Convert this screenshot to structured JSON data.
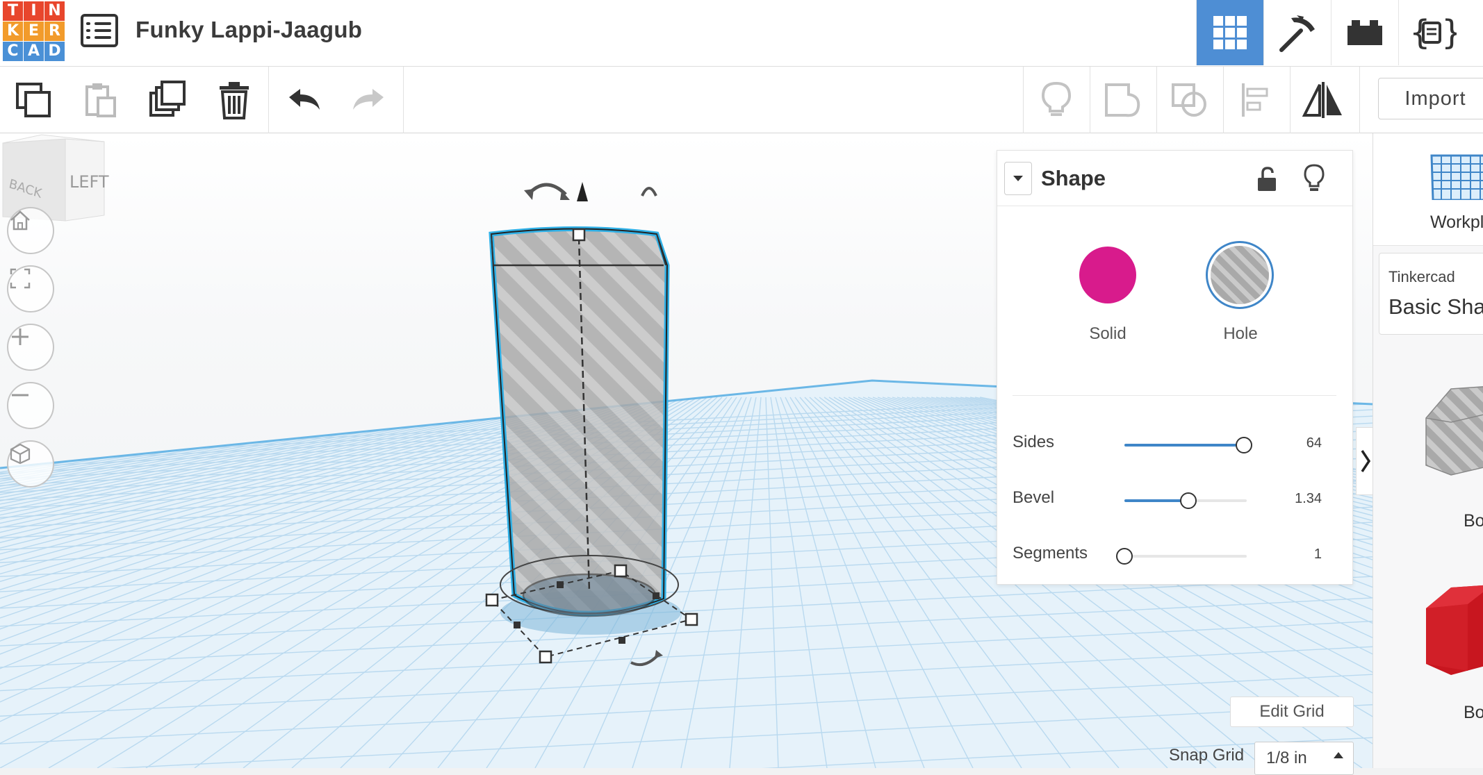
{
  "app": {
    "logo_letters": [
      "T",
      "I",
      "N",
      "K",
      "E",
      "R",
      "C",
      "A",
      "D"
    ],
    "logo_colors": [
      "#e8462c",
      "#e8462c",
      "#e8462c",
      "#f29b2b",
      "#f29b2b",
      "#f29b2b",
      "#4a90d6",
      "#4a90d6",
      "#4a90d6"
    ],
    "design_title": "Funky Lappi-Jaagub"
  },
  "view_tabs": [
    {
      "name": "3d-design-view",
      "icon": "grid-icon",
      "active": true
    },
    {
      "name": "codeblocks",
      "icon": "pickaxe-icon",
      "active": false
    },
    {
      "name": "bricks",
      "icon": "brick-icon",
      "active": false
    },
    {
      "name": "code",
      "icon": "code-icon",
      "active": false
    }
  ],
  "toolbar": {
    "left_tools": [
      "copy-icon",
      "paste-icon",
      "duplicate-icon",
      "delete-icon",
      "undo-icon",
      "redo-icon"
    ],
    "right_tools": [
      "lightbulb-icon",
      "group-icon",
      "ungroup-icon",
      "align-icon",
      "mirror-icon"
    ],
    "import_label": "Import"
  },
  "viewcube": {
    "face_left": "LEFT",
    "face_back": "BACK"
  },
  "inspector": {
    "title": "Shape",
    "solid_label": "Solid",
    "hole_label": "Hole",
    "solid_color": "#d81b8c",
    "params": [
      {
        "label": "Sides",
        "value": "64",
        "fraction": 0.98
      },
      {
        "label": "Bevel",
        "value": "1.34",
        "fraction": 0.52
      },
      {
        "label": "Segments",
        "value": "1",
        "fraction": 0.0
      }
    ]
  },
  "library": {
    "workplane_label": "Workplane",
    "category_super": "Tinkercad",
    "category_main": "Basic Shapes",
    "items": [
      "Box",
      "Box"
    ]
  },
  "grid": {
    "edit_label": "Edit Grid",
    "snap_label": "Snap Grid",
    "snap_value": "1/8 in"
  }
}
